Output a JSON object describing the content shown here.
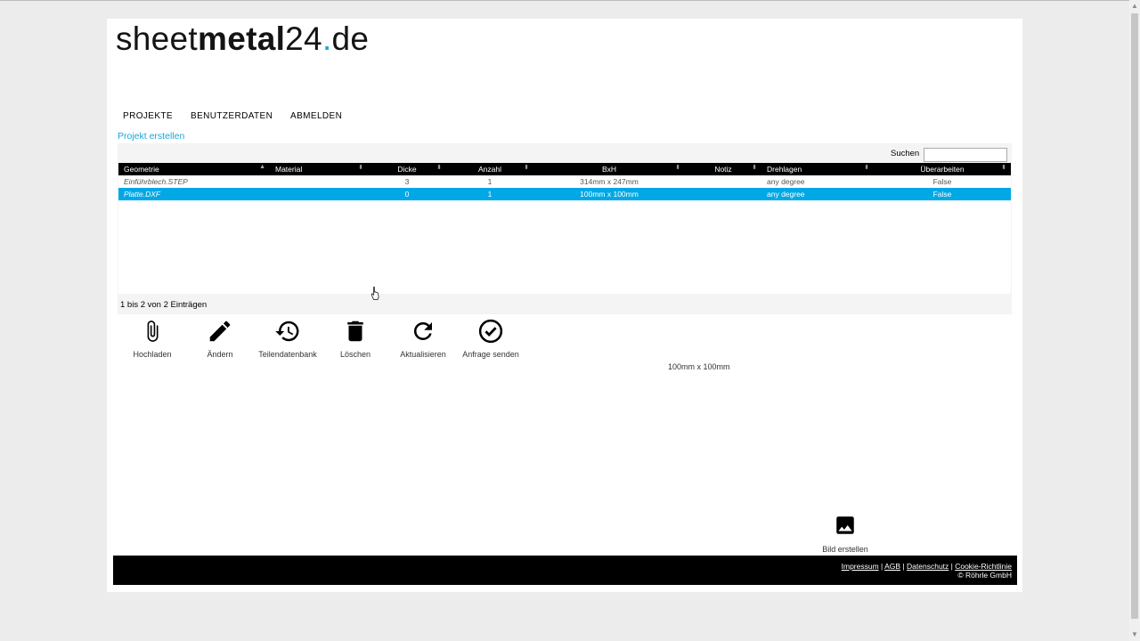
{
  "logo": {
    "part1": "sheet",
    "part2": "metal",
    "part3": "24",
    "dot": ".",
    "part4": "de"
  },
  "nav": {
    "items": [
      "PROJEKTE",
      "BENUTZERDATEN",
      "ABMELDEN"
    ]
  },
  "create_project_link": "Projekt erstellen",
  "search": {
    "label": "Suchen",
    "value": ""
  },
  "table": {
    "columns": [
      "Geometrie",
      "Material",
      "Dicke",
      "Anzahl",
      "BxH",
      "Notiz",
      "Drehlagen",
      "Überarbeiten"
    ],
    "sort_icons": {
      "sorted_asc": "▲",
      "sortable": "⬍"
    },
    "rows": [
      {
        "geometrie": "Einführblech.STEP",
        "material": "",
        "dicke": "3",
        "anzahl": "1",
        "bxh": "314mm x 247mm",
        "notiz": "",
        "drehlagen": "any degree",
        "ueberarbeiten": "False",
        "selected": false
      },
      {
        "geometrie": "Platte.DXF",
        "material": "",
        "dicke": "0",
        "anzahl": "1",
        "bxh": "100mm x 100mm",
        "notiz": "",
        "drehlagen": "any degree",
        "ueberarbeiten": "False",
        "selected": true
      }
    ]
  },
  "table_info": "1 bis 2 von 2 Einträgen",
  "toolbar": {
    "upload": "Hochladen",
    "edit": "Ändern",
    "parts_db": "Teilendatenbank",
    "delete": "Löschen",
    "refresh": "Aktualisieren",
    "send_request": "Anfrage senden"
  },
  "preview_dimension": "100mm x 100mm",
  "create_image": "Bild erstellen",
  "footer": {
    "links": [
      "Impressum",
      "AGB",
      "Datenschutz",
      "Cookie-Richtlinie"
    ],
    "separator": " | ",
    "copyright": "© Röhrle GmbH"
  },
  "colors": {
    "accent": "#1aa6d8",
    "selected_row": "#00a8e6",
    "header_bg": "#000000",
    "footer_bg": "#000000"
  }
}
